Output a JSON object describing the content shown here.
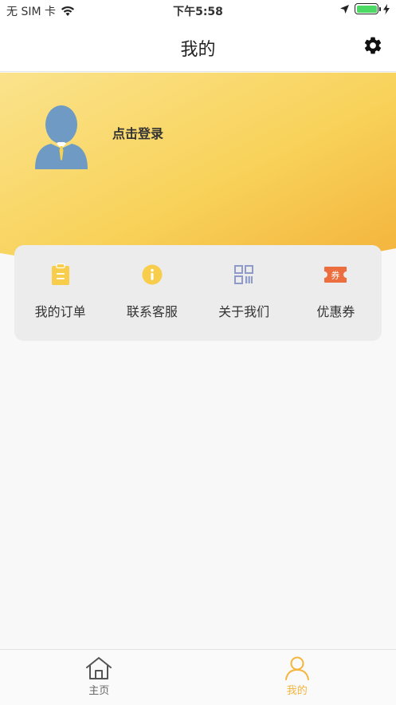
{
  "status_bar": {
    "carrier": "无 SIM 卡",
    "time": "下午5:58"
  },
  "nav": {
    "title": "我的",
    "settings_icon": "gear-icon"
  },
  "profile": {
    "login_text": "点击登录",
    "avatar_icon": "user-silhouette-icon"
  },
  "menu": {
    "items": [
      {
        "label": "我的订单",
        "icon": "clipboard-icon",
        "color": "#f7cd4b"
      },
      {
        "label": "联系客服",
        "icon": "info-icon",
        "color": "#f7cd4b"
      },
      {
        "label": "关于我们",
        "icon": "qrcode-icon",
        "color": "#8e9bc9"
      },
      {
        "label": "优惠券",
        "icon": "ticket-icon",
        "color": "#ec6d3d",
        "icon_text": "券"
      }
    ]
  },
  "tabs": [
    {
      "label": "主页",
      "icon": "home-icon",
      "active": false
    },
    {
      "label": "我的",
      "icon": "person-icon",
      "active": true
    }
  ],
  "colors": {
    "accent": "#f5b43c",
    "header_gradient_start": "#fbe389",
    "header_gradient_end": "#f4b73e"
  }
}
